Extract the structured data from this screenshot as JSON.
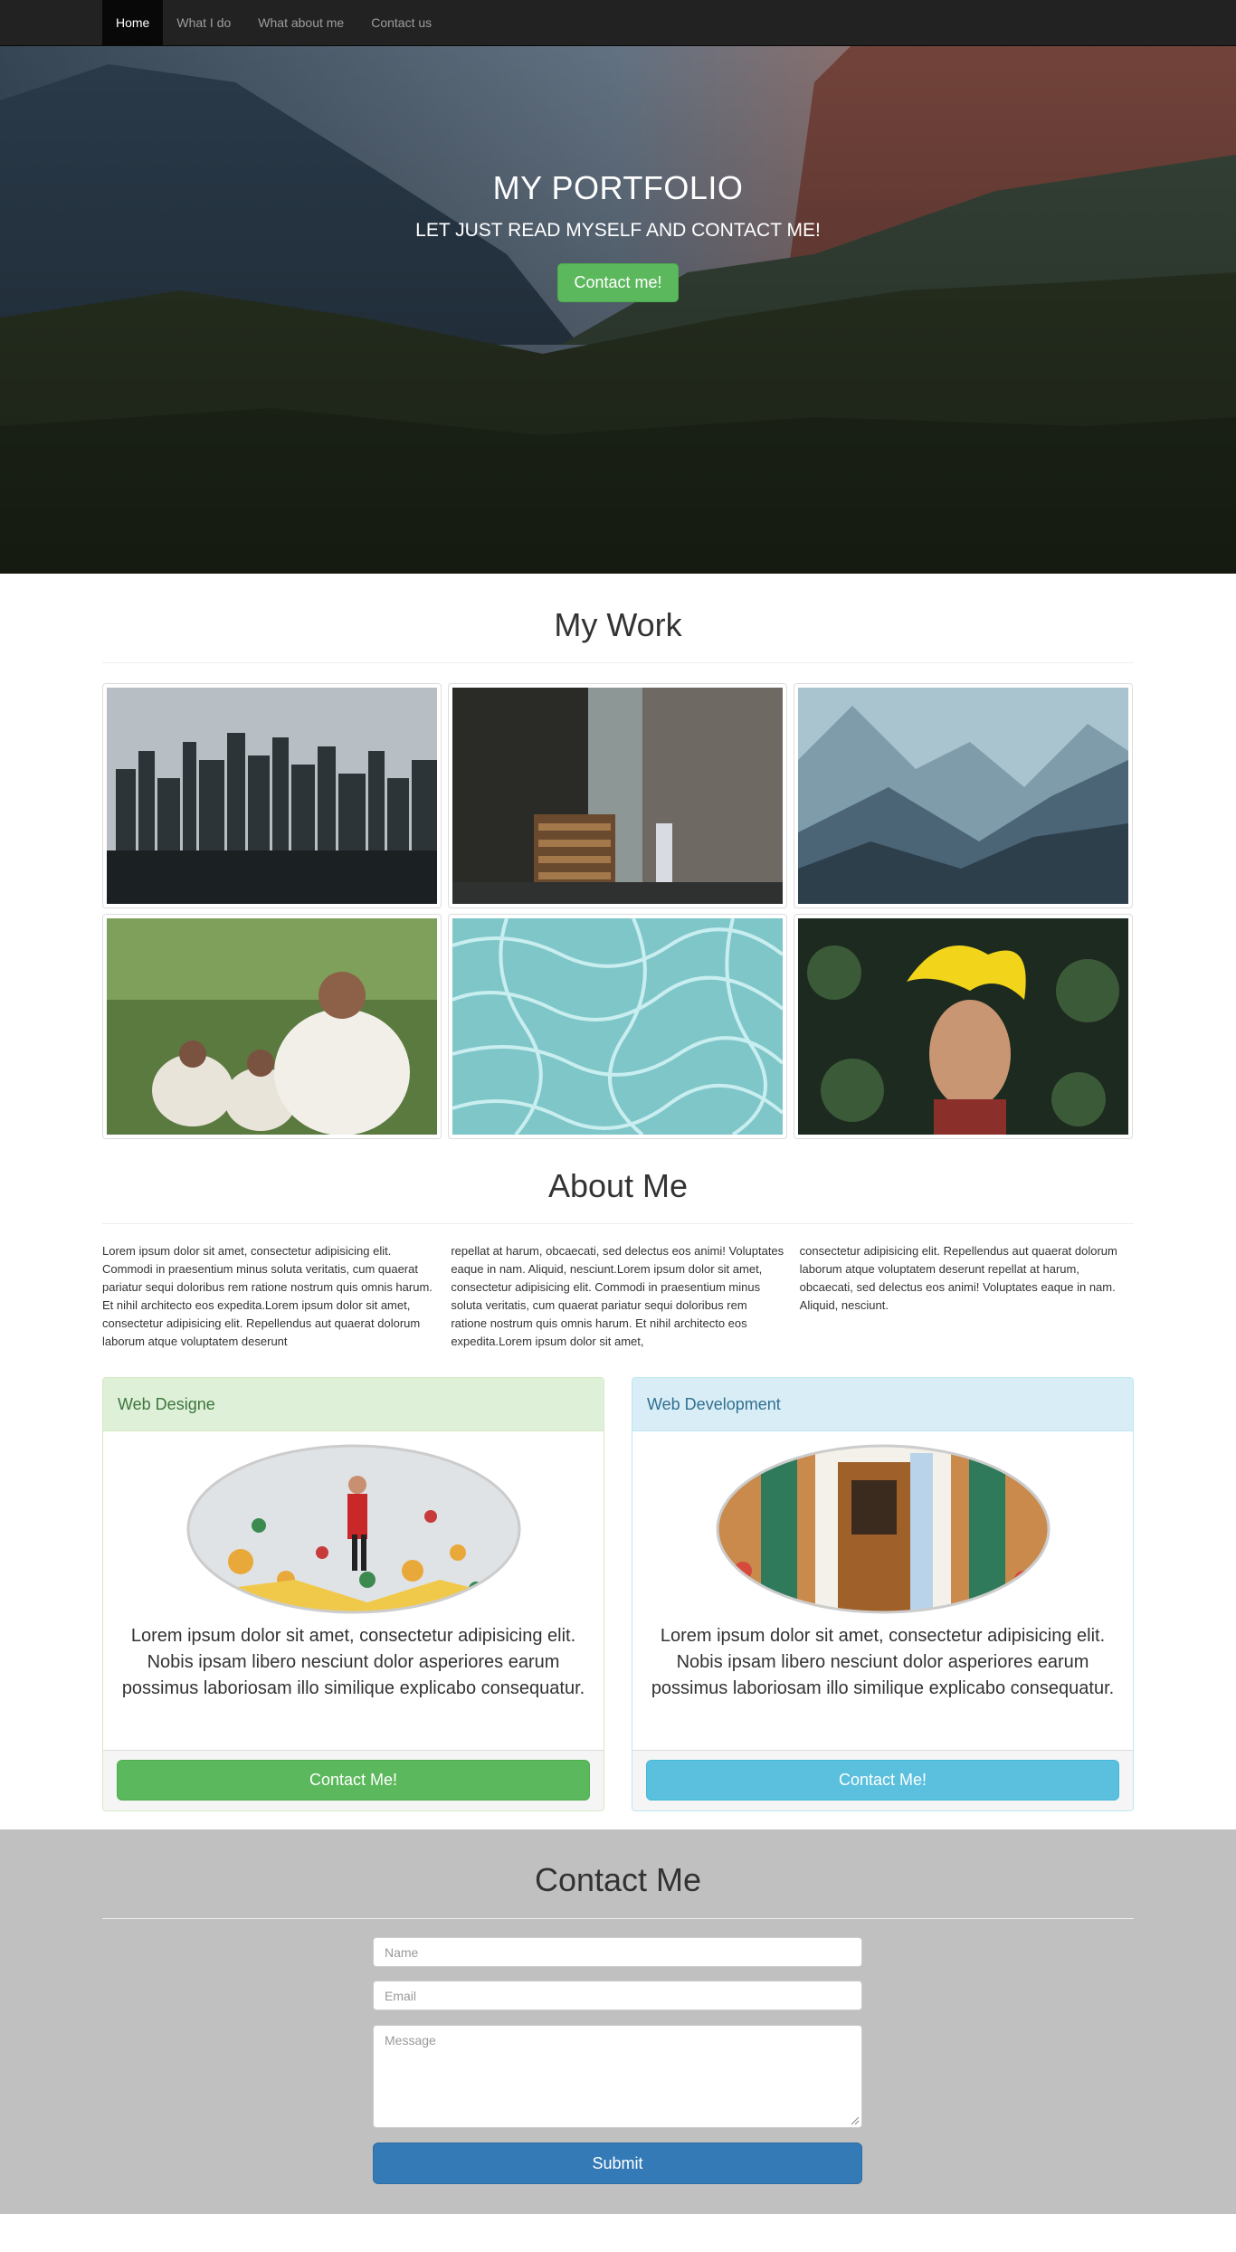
{
  "nav": {
    "items": [
      {
        "label": "Home",
        "active": true
      },
      {
        "label": "What I do",
        "active": false
      },
      {
        "label": "What about me",
        "active": false
      },
      {
        "label": "Contact us",
        "active": false
      }
    ]
  },
  "hero": {
    "title": "MY PORTFOLIO",
    "subtitle": "LET JUST READ MYSELF AND CONTACT ME!",
    "button_label": "Contact me!"
  },
  "work": {
    "title": "My Work",
    "images": [
      "city-skyline",
      "bookstore-street",
      "misty-mountains",
      "praying-people",
      "pool-water",
      "girl-yellow-headdress"
    ]
  },
  "about": {
    "title": "About Me",
    "columns": [
      "Lorem ipsum dolor sit amet, consectetur adipisicing elit. Commodi in praesentium minus soluta veritatis, cum quaerat pariatur sequi doloribus rem ratione nostrum quis omnis harum. Et nihil architecto eos expedita.Lorem ipsum dolor sit amet, consectetur adipisicing elit. Repellendus aut quaerat dolorum laborum atque voluptatem deserunt",
      "repellat at harum, obcaecati, sed delectus eos animi! Voluptates eaque in nam. Aliquid, nesciunt.Lorem ipsum dolor sit amet, consectetur adipisicing elit. Commodi in praesentium minus soluta veritatis, cum quaerat pariatur sequi doloribus rem ratione nostrum quis omnis harum. Et nihil architecto eos expedita.Lorem ipsum dolor sit amet,",
      "consectetur adipisicing elit. Repellendus aut quaerat dolorum laborum atque voluptatem deserunt repellat at harum, obcaecati, sed delectus eos animi! Voluptates eaque in nam. Aliquid, nesciunt."
    ]
  },
  "services": [
    {
      "heading": "Web Designe",
      "text": "Lorem ipsum dolor sit amet, consectetur adipisicing elit. Nobis ipsam libero nesciunt dolor asperiores earum possimus laboriosam illo similique explicabo consequatur.",
      "button_label": "Contact Me!",
      "image": "climbing-wall"
    },
    {
      "heading": "Web Development",
      "text": "Lorem ipsum dolor sit amet, consectetur adipisicing elit. Nobis ipsam libero nesciunt dolor asperiores earum possimus laboriosam illo similique explicabo consequatur.",
      "button_label": "Contact Me!",
      "image": "wooden-door"
    }
  ],
  "contact": {
    "title": "Contact Me",
    "name_placeholder": "Name",
    "email_placeholder": "Email",
    "message_placeholder": "Message",
    "submit_label": "Submit"
  },
  "colors": {
    "navbar": "#222222",
    "success": "#5cb85c",
    "info": "#5bc0de",
    "primary": "#337ab7",
    "contact_bg": "#c0c0c0"
  }
}
